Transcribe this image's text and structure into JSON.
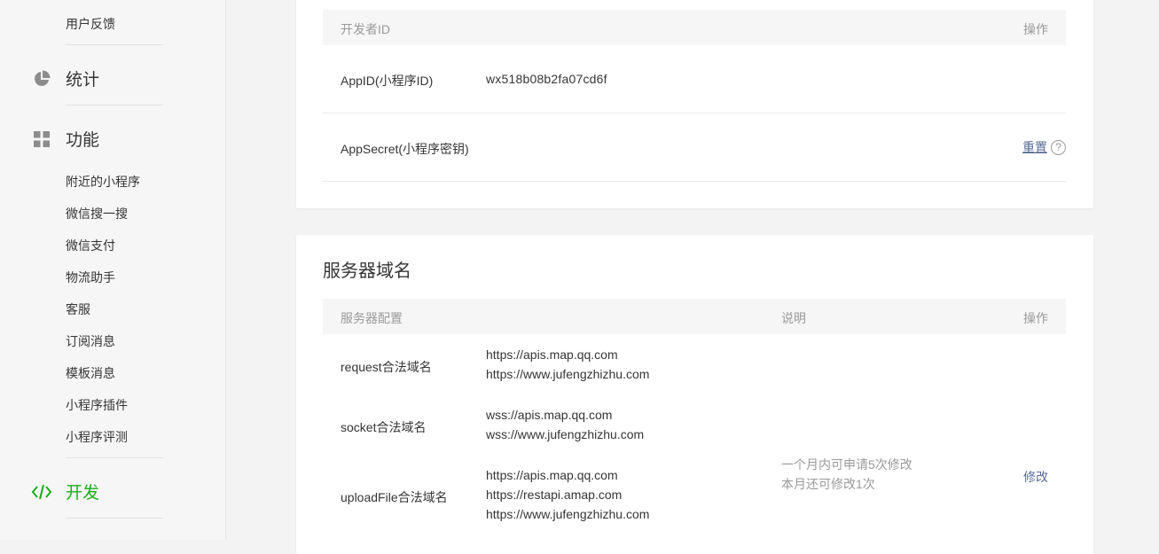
{
  "sidebar": {
    "top_item": "用户反馈",
    "stats_label": "统计",
    "features_label": "功能",
    "features_items": [
      "附近的小程序",
      "微信搜一搜",
      "微信支付",
      "物流助手",
      "客服",
      "订阅消息",
      "模板消息",
      "小程序插件",
      "小程序评测"
    ],
    "dev_label": "开发",
    "icons": {
      "stats": "pie-chart-icon",
      "features": "grid-icon",
      "dev": "code-icon"
    },
    "active_color": "#1aad19"
  },
  "developer_id": {
    "header_left": "开发者ID",
    "header_right": "操作",
    "appid_label": "AppID(小程序ID)",
    "appid_value": "wx518b08b2fa07cd6f",
    "appsecret_label": "AppSecret(小程序密钥)",
    "reset_label": "重置",
    "help_icon": "?"
  },
  "server_domain": {
    "title": "服务器域名",
    "header_config": "服务器配置",
    "header_desc": "说明",
    "header_action": "操作",
    "rows": [
      {
        "label": "request合法域名",
        "domains": [
          "https://apis.map.qq.com",
          "https://www.jufengzhizhu.com"
        ]
      },
      {
        "label": "socket合法域名",
        "domains": [
          "wss://apis.map.qq.com",
          "wss://www.jufengzhizhu.com"
        ]
      },
      {
        "label": "uploadFile合法域名",
        "domains": [
          "https://apis.map.qq.com",
          "https://restapi.amap.com",
          "https://www.jufengzhizhu.com"
        ]
      }
    ],
    "desc_lines": [
      "一个月内可申请5次修改",
      "本月还可修改1次"
    ],
    "modify_label": "修改"
  }
}
